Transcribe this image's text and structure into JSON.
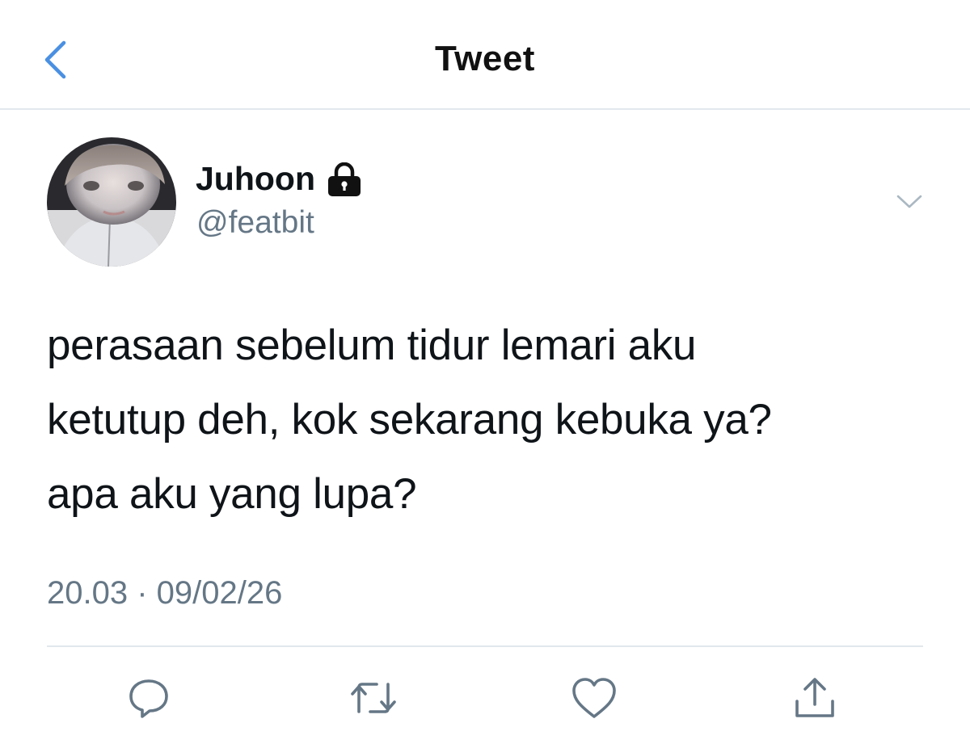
{
  "header": {
    "title": "Tweet",
    "back_icon": "chevron-left-icon",
    "accent_color": "#4a90e2"
  },
  "author": {
    "display_name": "Juhoon",
    "handle": "@featbit",
    "protected_icon": "lock-icon",
    "avatar": "avatar"
  },
  "tweet": {
    "lines": [
      "perasaan sebelum tidur lemari aku",
      "ketutup deh, kok sekarang kebuka ya?",
      "apa aku yang lupa?"
    ],
    "time": "20.03",
    "separator": "·",
    "date": "09/02/26"
  },
  "actions": [
    {
      "icon": "reply-icon"
    },
    {
      "icon": "retweet-icon"
    },
    {
      "icon": "like-icon"
    },
    {
      "icon": "share-icon"
    }
  ],
  "colors": {
    "text": "#0f1419",
    "secondary": "#657786",
    "divider": "#e1e8ed",
    "icon": "#657786"
  }
}
